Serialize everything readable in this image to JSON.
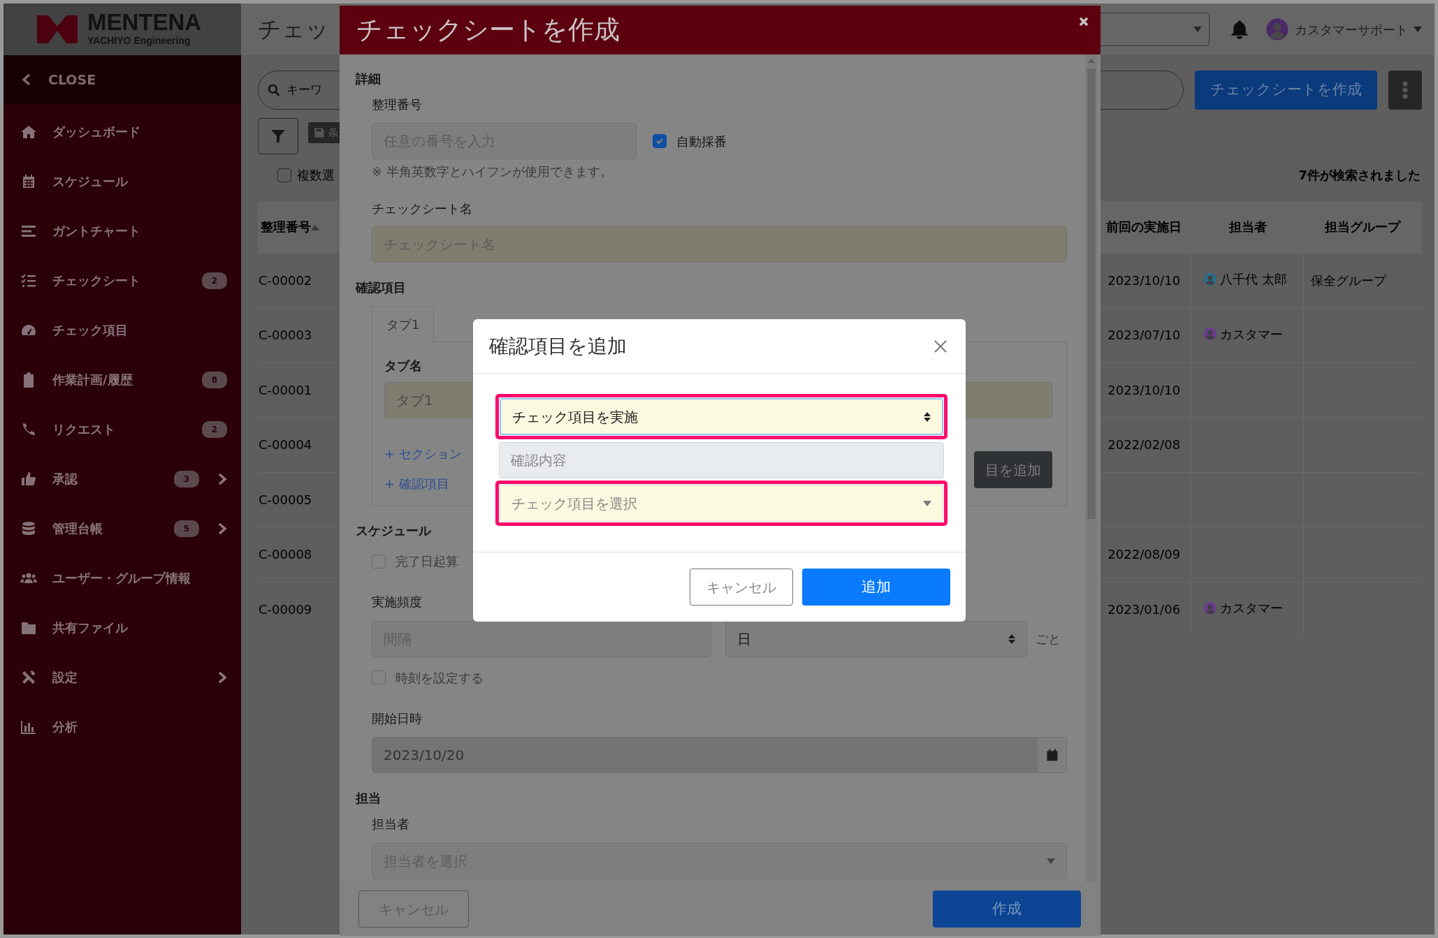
{
  "sidebar": {
    "logo_title": "MENTENA",
    "logo_subtitle": "YACHIYO Engineering",
    "close_label": "CLOSE",
    "items": [
      {
        "label": "ダッシュボード",
        "submenu": false
      },
      {
        "label": "スケジュール",
        "submenu": false
      },
      {
        "label": "ガントチャート",
        "submenu": false
      },
      {
        "label": "チェックシート",
        "badge": "2",
        "submenu": false
      },
      {
        "label": "チェック項目",
        "submenu": false
      },
      {
        "label": "作業計画/履歴",
        "badge": "8",
        "submenu": false
      },
      {
        "label": "リクエスト",
        "badge": "2",
        "submenu": false
      },
      {
        "label": "承認",
        "badge": "3",
        "submenu": true
      },
      {
        "label": "管理台帳",
        "badge": "5",
        "submenu": true
      },
      {
        "label": "ユーザー・グループ情報",
        "submenu": false
      },
      {
        "label": "共有ファイル",
        "submenu": false
      },
      {
        "label": "設定",
        "submenu": true
      },
      {
        "label": "分析",
        "submenu": false
      }
    ]
  },
  "header": {
    "page_title": "チェッ",
    "user_name": "カスタマーサポート"
  },
  "toolbar": {
    "search_placeholder": "キーワ",
    "saved_search_button": "条",
    "create_button": "チェックシートを作成",
    "multi_select": {
      "label": "複数選",
      "checked": false
    },
    "result_count": "7件が検索されました"
  },
  "table": {
    "columns": [
      "整理番号",
      "前回の実施日",
      "担当者",
      "担当グループ"
    ],
    "rows": [
      {
        "number": "C-00002",
        "last_date": "2023/10/10",
        "assignee": {
          "name": "八千代 太郎",
          "color": "#2b6b8a"
        },
        "group": "保全グループ"
      },
      {
        "number": "C-00003",
        "last_date": "2023/07/10",
        "assignee": {
          "name": "カスタマー",
          "color": "#6a3d8c"
        }
      },
      {
        "number": "C-00001",
        "last_date": "2023/10/10"
      },
      {
        "number": "C-00004",
        "last_date": "2022/02/08"
      },
      {
        "number": "C-00005"
      },
      {
        "number": "C-00008",
        "last_date": "2022/08/09"
      },
      {
        "number": "C-00009",
        "last_date": "2023/01/06",
        "assignee": {
          "name": "カスタマー",
          "color": "#6a3d8c"
        }
      }
    ]
  },
  "create_dialog": {
    "title": "チェックシートを作成",
    "details_heading": "詳細",
    "number_label": "整理番号",
    "number_placeholder": "任意の番号を入力",
    "auto_number": {
      "label": "自動採番",
      "checked": true
    },
    "number_hint": "※ 半角英数字とハイフンが使用できます。",
    "name_label": "チェックシート名",
    "name_placeholder": "チェックシート名",
    "items_heading": "確認項目",
    "tabs": [
      {
        "label": "タブ1",
        "selected": true
      }
    ],
    "tab_name_label": "タブ名",
    "tab_name_value": "タブ1",
    "add_section_link": "+ セクション",
    "add_item_link": "+ 確認項目",
    "add_item_button": "目を追加",
    "schedule_heading": "スケジュール",
    "from_completion": {
      "label": "完了日起算",
      "checked": false
    },
    "frequency_label": "実施頻度",
    "interval_placeholder": "間隔",
    "unit_value": "日",
    "unit_suffix": "ごと",
    "set_time": {
      "label": "時刻を設定する",
      "checked": false
    },
    "start_label": "開始日時",
    "start_value": "2023/10/20",
    "assignment_heading": "担当",
    "assignee_label": "担当者",
    "assignee_placeholder": "担当者を選択",
    "cancel_button": "キャンセル",
    "submit_button": "作成"
  },
  "add_item_dialog": {
    "title": "確認項目を追加",
    "type_value": "チェック項目を実施",
    "content_placeholder": "確認内容",
    "item_placeholder": "チェック項目を選択",
    "cancel_button": "キャンセル",
    "submit_button": "追加"
  }
}
